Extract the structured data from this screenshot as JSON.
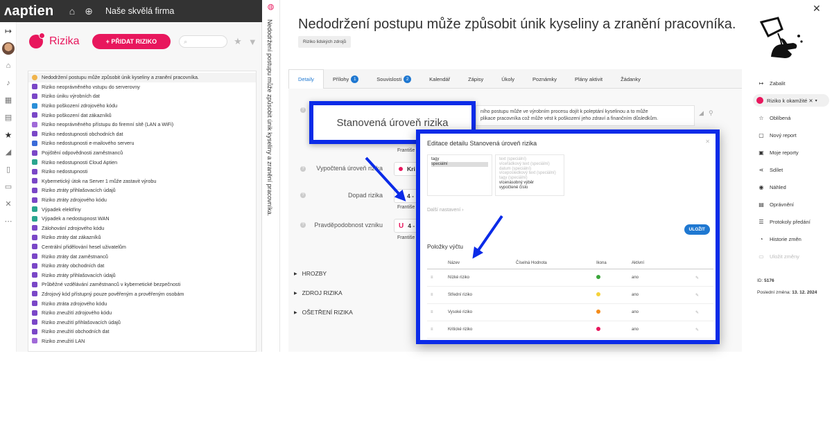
{
  "topbar": {
    "logo_text": "aptien",
    "company": "Naše skvělá firma"
  },
  "list_panel": {
    "title": "Rizika",
    "add_button": "+ PŘIDAT RIZIKO",
    "items": [
      {
        "label": "Nedodržení postupu může způsobit únik kyseliny a zranění pracovníka.",
        "color": "#f0b44c",
        "selected": true
      },
      {
        "label": "Riziko neoprávněného vstupu do serverovny",
        "color": "#7a47c7"
      },
      {
        "label": "Riziko úniku výrobních dat",
        "color": "#7a47c7"
      },
      {
        "label": "Riziko poškození zdrojového kódu",
        "color": "#2a8fd8"
      },
      {
        "label": "Riziko poškození dat zákazníků",
        "color": "#7a47c7"
      },
      {
        "label": "Riziko neoprávněného přístupu do firemní sítě (LAN a WiFi)",
        "color": "#a06ad8"
      },
      {
        "label": "Riziko nedostupnosti obchodních dat",
        "color": "#7a47c7"
      },
      {
        "label": "Riziko nedostupnosti e-mailového serveru",
        "color": "#3a6bd8"
      },
      {
        "label": "Pojištění odpovědnosti zaměstnanců",
        "color": "#7a47c7"
      },
      {
        "label": "Riziko nedostupnosti Cloud Aptien",
        "color": "#2aa58f"
      },
      {
        "label": "Riziko nedostupnosti",
        "color": "#7a47c7"
      },
      {
        "label": "Kybernetický útok na Server 1 může zastavit výrobu",
        "color": "#7a47c7"
      },
      {
        "label": "Riziko ztráty přihlašovacích údajů",
        "color": "#7a47c7"
      },
      {
        "label": "Riziko ztráty zdrojového kódu",
        "color": "#7a47c7"
      },
      {
        "label": "Výpadek elektřiny",
        "color": "#2aa58f"
      },
      {
        "label": "Výpadek a nedostupnost WAN",
        "color": "#2aa58f"
      },
      {
        "label": "Zálohování zdrojového kódu",
        "color": "#7a47c7"
      },
      {
        "label": "Riziko ztráty dat zákazníků",
        "color": "#7a47c7"
      },
      {
        "label": "Centrální přidělování hesel uživatelům",
        "color": "#7a47c7"
      },
      {
        "label": "Riziko ztráty dat zaměstnanců",
        "color": "#7a47c7"
      },
      {
        "label": "Riziko ztráty obchodních dat",
        "color": "#7a47c7"
      },
      {
        "label": "Riziko ztráty přihlašovacích údajů",
        "color": "#7a47c7"
      },
      {
        "label": "Průběžné vzdělávání zaměstnanců v kybernetické bezpečnosti",
        "color": "#7a47c7"
      },
      {
        "label": "Zdrojový kód přístupný pouze pověřeným a prověřeným osobám",
        "color": "#7a47c7"
      },
      {
        "label": "Riziko ztráta zdrojového kódu",
        "color": "#7a47c7"
      },
      {
        "label": "Riziko zneužití zdrojového kódu",
        "color": "#7a47c7"
      },
      {
        "label": "Riziko zneužití přihlašovacích údajů",
        "color": "#7a47c7"
      },
      {
        "label": "Riziko zneužití obchodních dat",
        "color": "#7a47c7"
      },
      {
        "label": "Riziko zneužití LAN",
        "color": "#a06ad8"
      }
    ]
  },
  "vertical_title": "Nedodržení postupu může způsobit únik kyseliny a zranění pracovníka.",
  "detail": {
    "title": "Nedodržení postupu může způsobit únik kyseliny a zranění pracovníka.",
    "tag": "Riziko lidských zdrojů",
    "tabs": [
      {
        "label": "Detaily",
        "badge": "",
        "active": true
      },
      {
        "label": "Přílohy",
        "badge": "1"
      },
      {
        "label": "Souvislosti",
        "badge": "2"
      },
      {
        "label": "Kalendář",
        "badge": ""
      },
      {
        "label": "Zápisy",
        "badge": ""
      },
      {
        "label": "Úkoly",
        "badge": ""
      },
      {
        "label": "Poznámky",
        "badge": ""
      },
      {
        "label": "Plány aktivit",
        "badge": ""
      },
      {
        "label": "Žádanky",
        "badge": ""
      }
    ],
    "description_line1": "ního postupu může ve výrobním procesu dojít k poleptání kyselinou a to může",
    "description_line2": "plikace pracovníka což může vést k poškození jeho zdraví a finančním důsledkům.",
    "field_vypoctena_label": "Vypočtená úroveň rizika",
    "field_vypoctena_value": "Kri",
    "field_dopad_label": "Dopad rizika",
    "field_dopad_value": "4 -",
    "field_prav_label": "Pravděpodobnost vzniku",
    "field_prav_value": "4 -",
    "sub_name": "Františe",
    "sections": [
      "HROZBY",
      "ZDROJ RIZIKA",
      "OŠETŘENÍ RIZIKA"
    ]
  },
  "callout": {
    "text": "Stanovená úroveň rizika"
  },
  "modal": {
    "title": "Editace detailu Stanovená úroveň rizika",
    "selected_options": [
      "tagy",
      "speciální"
    ],
    "available_options": [
      {
        "label": "text (speciální)",
        "dim": true
      },
      {
        "label": "víceřádkový text (speciální)",
        "dim": true
      },
      {
        "label": "datum (speciální)",
        "dim": true
      },
      {
        "label": "víceposledkový text (speciální)",
        "dim": true
      },
      {
        "label": "tagy (speciální)",
        "dim": true
      },
      {
        "label": "vícenásobný výběr",
        "dim": false
      },
      {
        "label": "vypočtené číslo",
        "dim": false
      }
    ],
    "more_settings": "Další nastavení",
    "save_button": "ULOŽIT",
    "values_title": "Položky výčtu",
    "columns": [
      "Název",
      "Číselná Hodnota",
      "Ikona",
      "Aktivní"
    ],
    "rows": [
      {
        "name": "Nízké riziko",
        "value": "",
        "icon_color": "#3aa53a",
        "active": "ano"
      },
      {
        "name": "Střední riziko",
        "value": "",
        "icon_color": "#f5d23a",
        "active": "ano"
      },
      {
        "name": "Vysoké riziko",
        "value": "",
        "icon_color": "#f58c1a",
        "active": "ano"
      },
      {
        "name": "Kritické riziko",
        "value": "",
        "icon_color": "#e8175d",
        "active": "ano"
      }
    ]
  },
  "right_panel": {
    "collapse": "Zabalit",
    "status": "Riziko k okamžité",
    "status_color": "#e8175d",
    "items": [
      {
        "label": "Oblíbená",
        "icon": "star-icon",
        "dim": false
      },
      {
        "label": "Nový report",
        "icon": "report-icon",
        "dim": false
      },
      {
        "label": "Moje reporty",
        "icon": "reports-icon",
        "dim": false
      },
      {
        "label": "Sdílet",
        "icon": "share-icon",
        "dim": false
      },
      {
        "label": "Náhled",
        "icon": "eye-icon",
        "dim": false
      },
      {
        "label": "Oprávnění",
        "icon": "permissions-icon",
        "dim": false
      },
      {
        "label": "Protokoly předání",
        "icon": "protocol-icon",
        "dim": false
      },
      {
        "label": "Historie změn",
        "icon": "history-icon",
        "dim": false
      },
      {
        "label": "Uložit změny",
        "icon": "save-icon",
        "dim": true
      }
    ],
    "id_label": "ID:",
    "id_value": "5176",
    "last_change_label": "Poslední změna:",
    "last_change_value": "13. 12. 2024"
  }
}
